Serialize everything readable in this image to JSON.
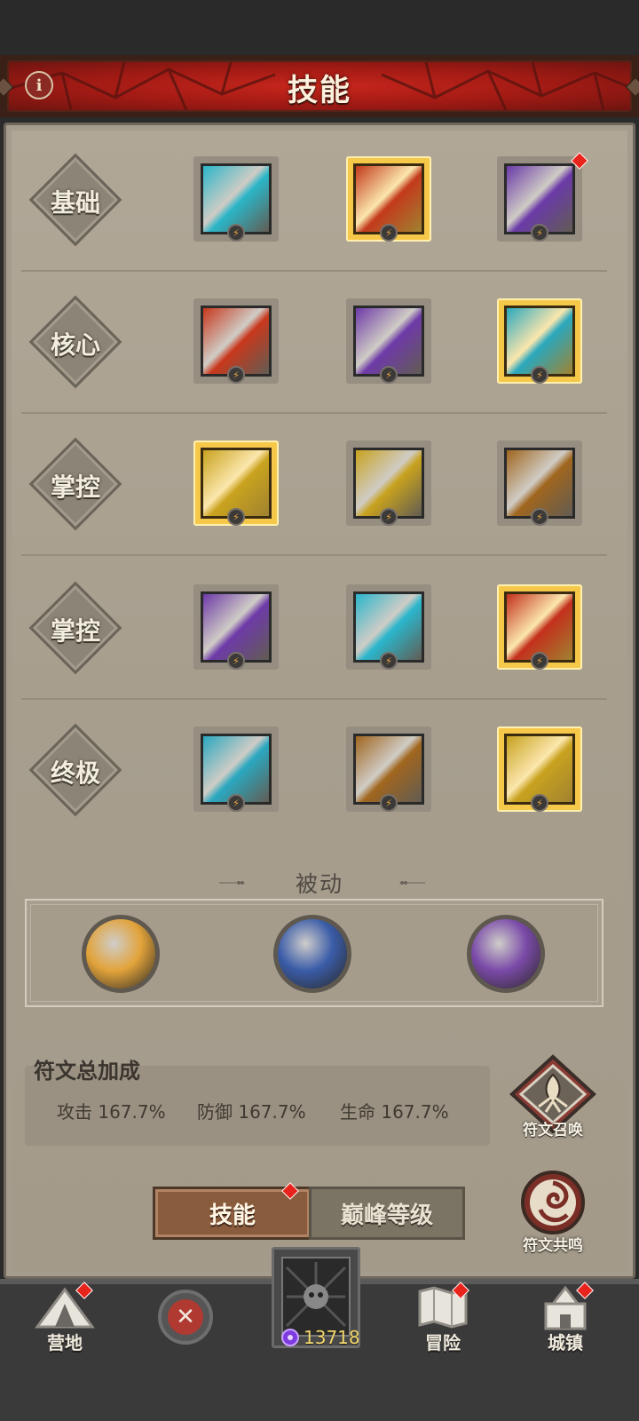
{
  "header": {
    "title": "技能",
    "info_icon": "info-icon"
  },
  "rows": [
    {
      "label": "基础",
      "skills": [
        {
          "name": "ice-arrow-icon",
          "color": "#2ab6c8",
          "gold": false,
          "badge": "⚡"
        },
        {
          "name": "fire-slash-icon",
          "color": "#c33a1c",
          "gold": true,
          "badge": "⚡"
        },
        {
          "name": "lightning-icon",
          "color": "#6a3aa8",
          "gold": false,
          "badge": "⚡",
          "new": true
        }
      ]
    },
    {
      "label": "核心",
      "skills": [
        {
          "name": "fireball-icon",
          "color": "#c8381c",
          "gold": false,
          "badge": "⚡"
        },
        {
          "name": "thunder-fist-icon",
          "color": "#6e3aa8",
          "gold": false,
          "badge": "⚡"
        },
        {
          "name": "ice-shards-icon",
          "color": "#2aa8be",
          "gold": true,
          "badge": "⚡"
        }
      ]
    },
    {
      "label": "掌控",
      "skills": [
        {
          "name": "golden-crown-icon",
          "color": "#c9a31e",
          "gold": true,
          "badge": "⚡"
        },
        {
          "name": "golden-rush-icon",
          "color": "#c8a21e",
          "gold": false,
          "badge": "⚡"
        },
        {
          "name": "earth-orb-icon",
          "color": "#a0661e",
          "gold": false,
          "badge": "⚡"
        }
      ]
    },
    {
      "label": "掌控",
      "skills": [
        {
          "name": "thunder-orb-icon",
          "color": "#6e3aa8",
          "gold": false,
          "badge": "⚡"
        },
        {
          "name": "snowflake-icon",
          "color": "#2ab6cc",
          "gold": false,
          "badge": "⚡"
        },
        {
          "name": "fire-beast-icon",
          "color": "#c3301c",
          "gold": true,
          "badge": "⚡"
        }
      ]
    },
    {
      "label": "终极",
      "skills": [
        {
          "name": "tornado-icon",
          "color": "#2aa8c0",
          "gold": false,
          "badge": "⚡"
        },
        {
          "name": "clone-army-icon",
          "color": "#a0661e",
          "gold": false,
          "badge": "⚡"
        },
        {
          "name": "golden-avatar-icon",
          "color": "#c8a21e",
          "gold": true,
          "badge": "⚡"
        }
      ]
    }
  ],
  "passive": {
    "title": "被动",
    "orbs": [
      {
        "name": "golden-rune-orb-icon",
        "color": "#e2a33a"
      },
      {
        "name": "blue-leaf-orb-icon",
        "color": "#3a5ca8"
      },
      {
        "name": "hooded-shadow-orb-icon",
        "color": "#7a4aa8"
      }
    ]
  },
  "rune_bonus": {
    "title": "符文总加成",
    "stats": [
      "攻击 167.7%",
      "防御 167.7%",
      "生命 167.7%"
    ],
    "summon_label": "符文召唤",
    "resonance_label": "符文共鸣"
  },
  "tabs": {
    "active": "技能",
    "inactive": "巅峰等级"
  },
  "nav": {
    "camp": "营地",
    "adventure": "冒险",
    "town": "城镇",
    "gems": "13718"
  }
}
